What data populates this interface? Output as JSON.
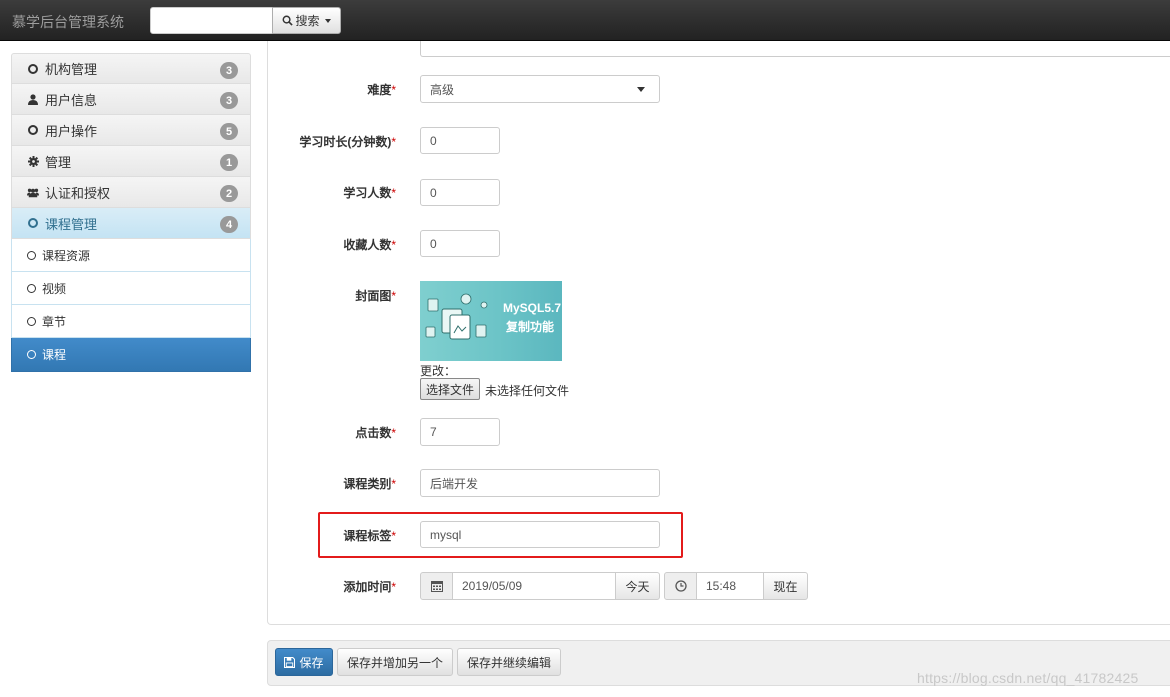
{
  "app": {
    "title": "慕学后台管理系统"
  },
  "search": {
    "placeholder": "",
    "button_label": "搜索"
  },
  "sidebar": {
    "items": [
      {
        "label": "机构管理",
        "badge": "3",
        "icon": "circle-icon"
      },
      {
        "label": "用户信息",
        "badge": "3",
        "icon": "user-icon"
      },
      {
        "label": "用户操作",
        "badge": "5",
        "icon": "circle-icon"
      },
      {
        "label": "管理",
        "badge": "1",
        "icon": "gear-icon"
      },
      {
        "label": "认证和授权",
        "badge": "2",
        "icon": "users-icon"
      },
      {
        "label": "课程管理",
        "badge": "4",
        "icon": "circle-icon"
      }
    ],
    "subitems": [
      {
        "label": "课程资源"
      },
      {
        "label": "视频"
      },
      {
        "label": "章节"
      },
      {
        "label": "课程",
        "active": true
      }
    ]
  },
  "form": {
    "required_mark": "*",
    "difficulty": {
      "label": "难度",
      "value": "高级"
    },
    "learn_time": {
      "label": "学习时长(分钟数)",
      "value": "0"
    },
    "students": {
      "label": "学习人数",
      "value": "0"
    },
    "favorites": {
      "label": "收藏人数",
      "value": "0"
    },
    "cover": {
      "label": "封面图",
      "image_title": "MySQL5.7",
      "image_subtitle": "复制功能",
      "change_label": "更改：",
      "choose_file": "选择文件",
      "no_file": "未选择任何文件"
    },
    "clicks": {
      "label": "点击数",
      "value": "7"
    },
    "category": {
      "label": "课程类别",
      "value": "后端开发"
    },
    "tag": {
      "label": "课程标签",
      "value": "mysql"
    },
    "add_time": {
      "label": "添加时间",
      "date": "2019/05/09",
      "today": "今天",
      "time": "15:48",
      "now": "现在"
    }
  },
  "actions": {
    "save": "保存",
    "save_add": "保存并增加另一个",
    "save_continue": "保存并继续编辑"
  },
  "watermark": "https://blog.csdn.net/qq_41782425",
  "colors": {
    "accent": "#428bca",
    "highlight": "#e31b1b",
    "navbar": "#222222"
  }
}
